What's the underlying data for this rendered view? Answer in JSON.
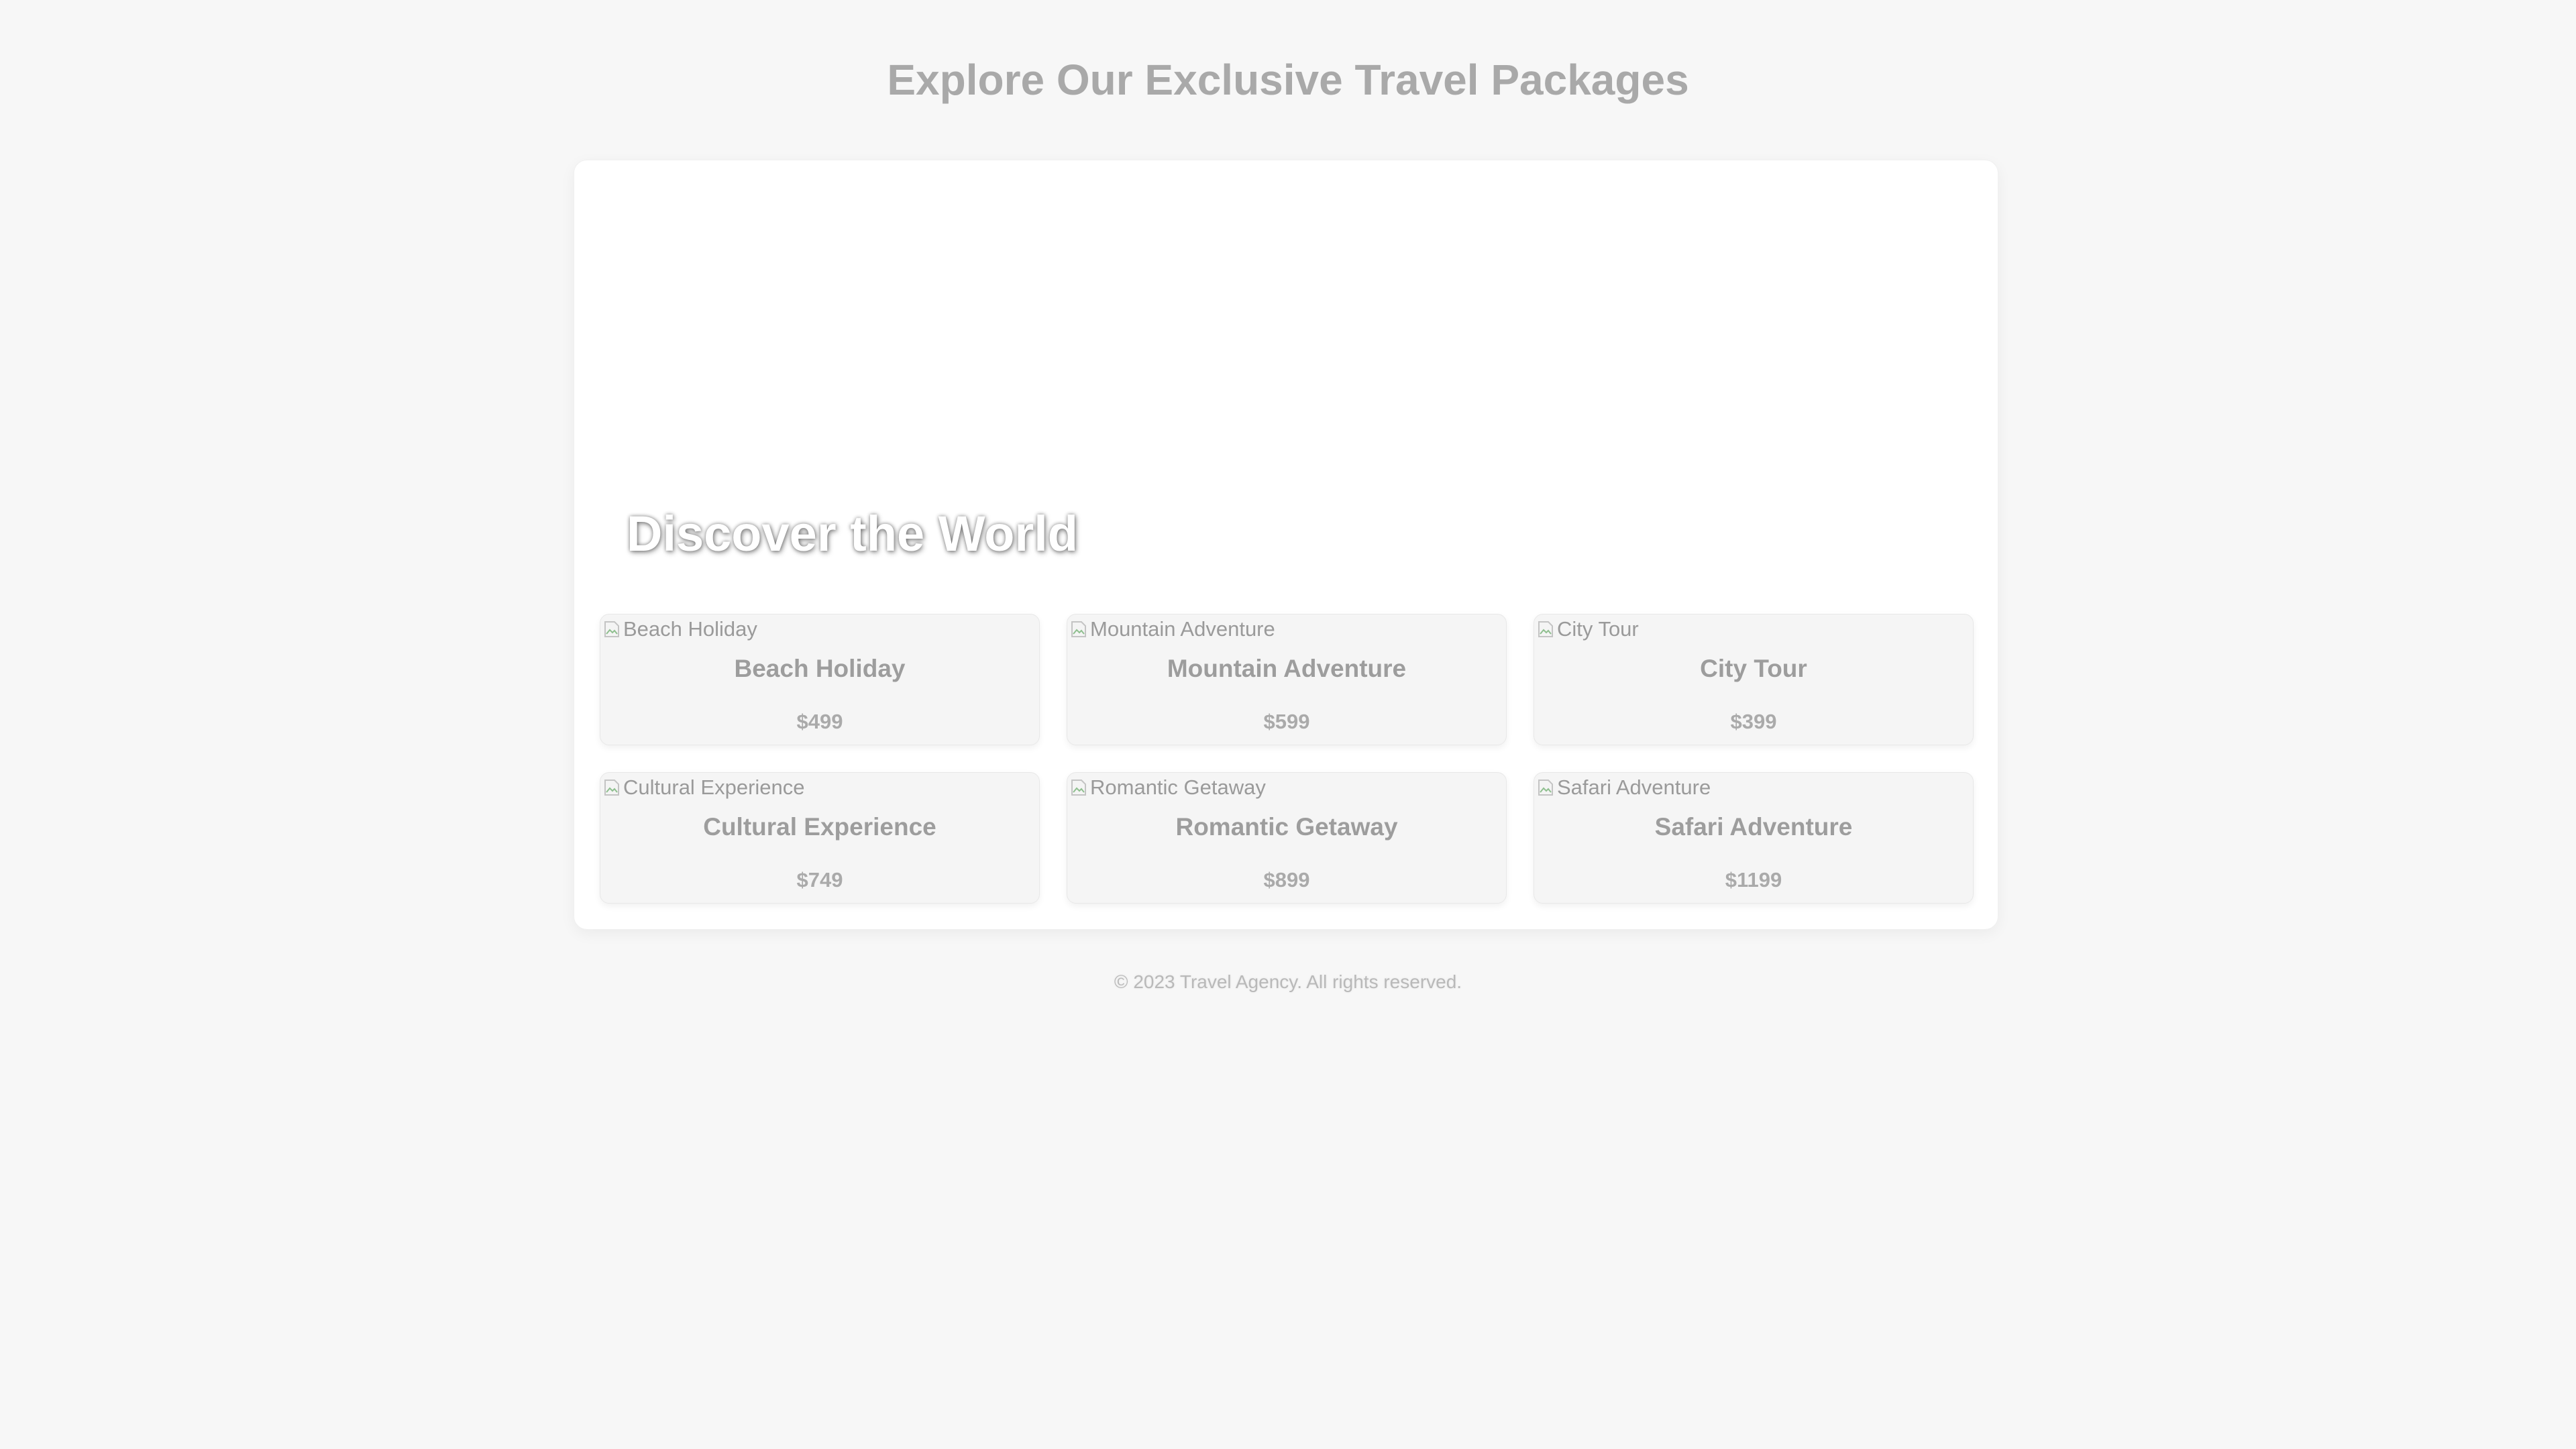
{
  "header": {
    "title": "Explore Our Exclusive Travel Packages"
  },
  "hero": {
    "heading": "Discover the World"
  },
  "packages": [
    {
      "alt": "Beach Holiday",
      "name": "Beach Holiday",
      "price": "$499"
    },
    {
      "alt": "Mountain Adventure",
      "name": "Mountain Adventure",
      "price": "$599"
    },
    {
      "alt": "City Tour",
      "name": "City Tour",
      "price": "$399"
    },
    {
      "alt": "Cultural Experience",
      "name": "Cultural Experience",
      "price": "$749"
    },
    {
      "alt": "Romantic Getaway",
      "name": "Romantic Getaway",
      "price": "$899"
    },
    {
      "alt": "Safari Adventure",
      "name": "Safari Adventure",
      "price": "$1199"
    }
  ],
  "footer": {
    "text": "© 2023 Travel Agency. All rights reserved."
  },
  "icons": {
    "broken_image": "broken-image-icon"
  },
  "colors": {
    "background": "#f7f7f7",
    "card": "#ffffff",
    "package_card": "#f5f5f5",
    "title_text": "#a9a9a9",
    "hero_text": "#ffffff"
  }
}
